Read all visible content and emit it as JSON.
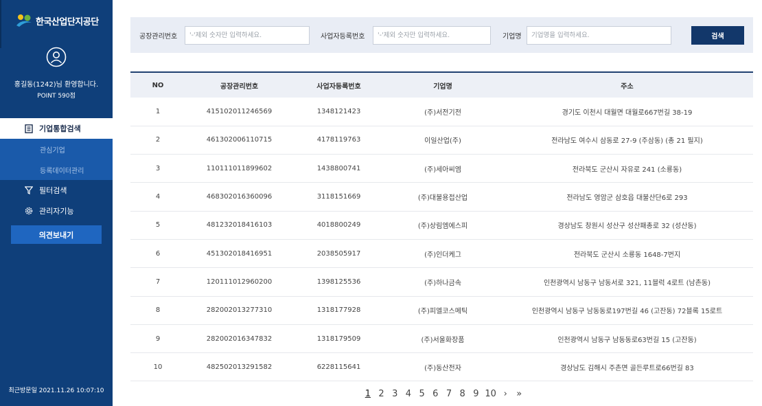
{
  "sidebar": {
    "logo_text": "한국산업단지공단",
    "welcome": "홍길동(1242)님 환영합니다.",
    "point": "POINT 590점",
    "main_menu": "기업통합검색",
    "sub_items": [
      "관심기업",
      "등록데이터관리"
    ],
    "filter_search": "필터검색",
    "admin": "관리자기능",
    "opinion_button": "의견보내기",
    "last_visit": "최근방문일 2021.11.26 10:07:10"
  },
  "search": {
    "factory_label": "공장관리번호",
    "factory_placeholder": "'-'제외 숫자만 입력하세요.",
    "biz_label": "사업자등록번호",
    "biz_placeholder": "'-'제외 숫자만 입력하세요.",
    "company_label": "기업명",
    "company_placeholder": "기업명을 입력하세요.",
    "button": "검색"
  },
  "table": {
    "headers": [
      "NO",
      "공장관리번호",
      "사업자등록번호",
      "기업명",
      "주소"
    ],
    "rows": [
      [
        "1",
        "415102011246569",
        "1348121423",
        "(주)서전기전",
        "경기도 이천시 대월면 대월로667번길 38-19"
      ],
      [
        "2",
        "461302006110715",
        "4178119763",
        "이일산업(주)",
        "전라남도 여수시 삼동로 27-9 (주삼동) (총 21 필지)"
      ],
      [
        "3",
        "110111011899602",
        "1438800741",
        "(주)세아씨엠",
        "전라북도 군산시 자유로 241 (소룡동)"
      ],
      [
        "4",
        "468302016360096",
        "3118151669",
        "(주)대불용접산업",
        "전라남도 영암군 삼호읍 대불산단6로 293"
      ],
      [
        "5",
        "481232018416103",
        "4018800249",
        "(주)상림엠에스피",
        "경상남도 창원시 성산구 성산패총로 32 (성산동)"
      ],
      [
        "6",
        "451302018416951",
        "2038505917",
        "(주)인더케그",
        "전라북도 군산시 소룡동 1648-7번지"
      ],
      [
        "7",
        "120111012960200",
        "1398125536",
        "(주)하나금속",
        "인천광역시 남동구 남동서로 321, 11블럭 4로트 (남촌동)"
      ],
      [
        "8",
        "282002013277310",
        "1318177928",
        "(주)피엘코스메틱",
        "인천광역시 남동구 남동동로197번길 46 (고잔동) 72블록 15로트"
      ],
      [
        "9",
        "282002016347832",
        "1318179509",
        "(주)서울화장품",
        "인천광역시 남동구 남동동로63번길 15 (고잔동)"
      ],
      [
        "10",
        "482502013291582",
        "6228115641",
        "(주)동산전자",
        "경상남도 김해시 주촌면 골든루트로66번길 83"
      ]
    ]
  },
  "pagination": {
    "pages": [
      "1",
      "2",
      "3",
      "4",
      "5",
      "6",
      "7",
      "8",
      "9",
      "10"
    ],
    "current": "1",
    "next": "›",
    "last": "»"
  },
  "colors": {
    "sidebar_bg": "#0f3f7a",
    "sub_menu_bg": "#1a5aaa",
    "search_button": "#12376a",
    "header_border": "#1f3f70"
  }
}
